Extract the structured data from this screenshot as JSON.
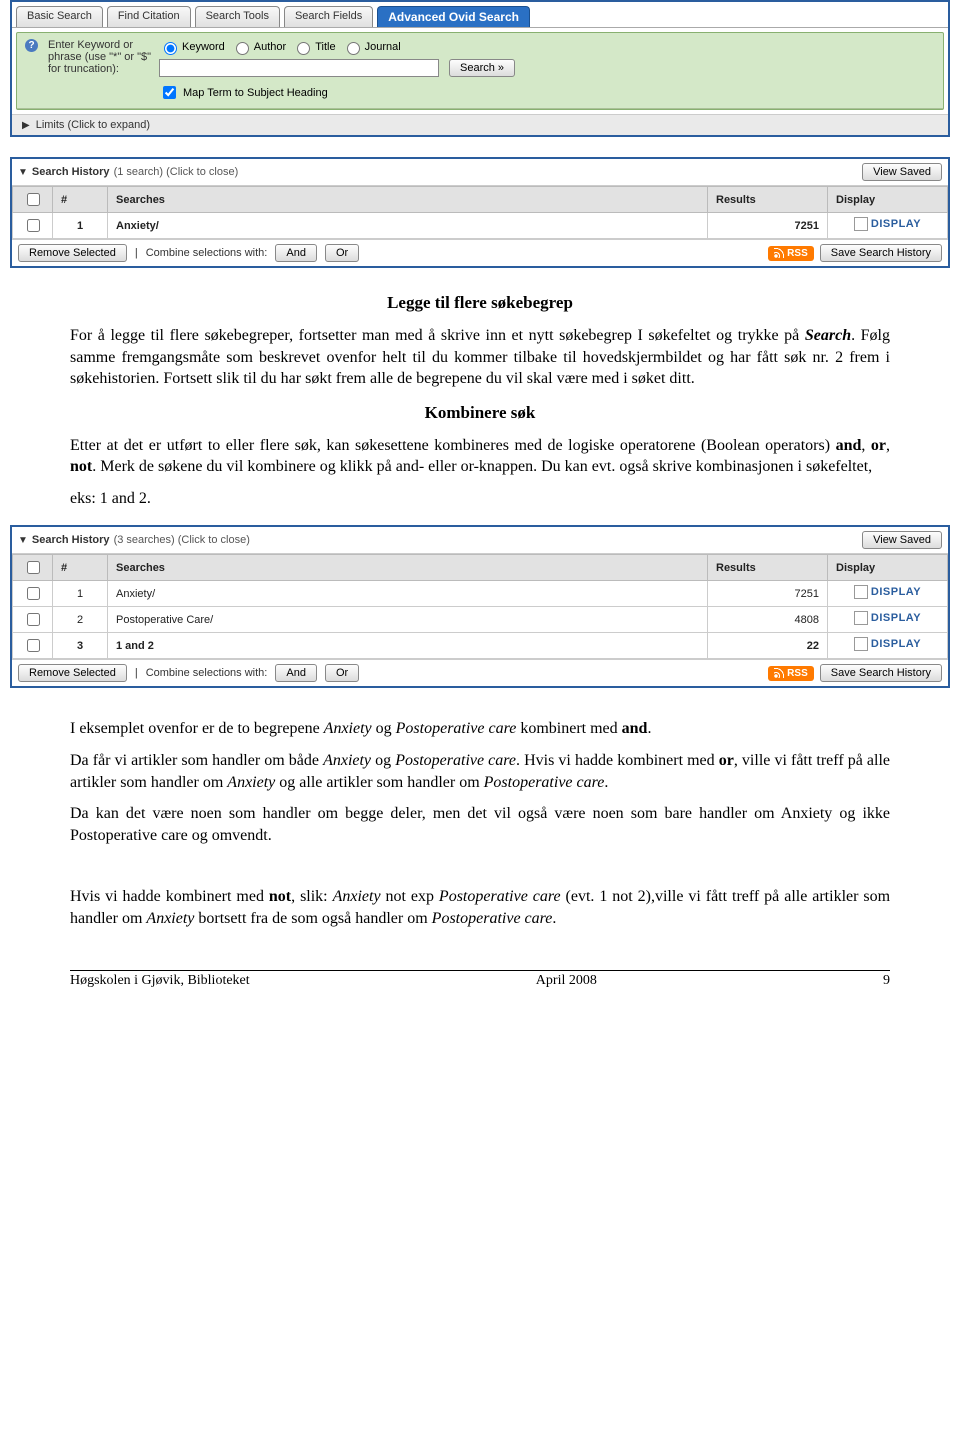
{
  "top_panel": {
    "tabs": [
      "Basic Search",
      "Find Citation",
      "Search Tools",
      "Search Fields",
      "Advanced Ovid Search"
    ],
    "active_tab": 4,
    "keyword_label": "Enter Keyword or phrase (use \"*\" or \"$\" for truncation):",
    "radios": [
      "Keyword",
      "Author",
      "Title",
      "Journal"
    ],
    "map_label": "Map Term to Subject Heading",
    "search_btn": "Search »",
    "limits": "Limits  (Click to expand)"
  },
  "hist1": {
    "title": "Search History",
    "count": "(1 search) (Click to close)",
    "view_saved": "View Saved",
    "headers": [
      "#",
      "Searches",
      "Results",
      "Display"
    ],
    "rows": [
      {
        "n": "1",
        "s": "Anxiety/",
        "r": "7251",
        "d": "DISPLAY"
      }
    ],
    "remove": "Remove Selected",
    "combine_label": "Combine selections with:",
    "and": "And",
    "or": "Or",
    "rss": "RSS",
    "save_hist": "Save Search History"
  },
  "text1": {
    "h1": "Legge til flere søkebegrep",
    "p1a": "For å legge til flere søkebegreper, fortsetter man med å skrive inn et nytt søkebegrep I søkefeltet og trykke på ",
    "p1b": "Search",
    "p1c": ". Følg samme fremgangsmåte som beskrevet ovenfor helt til du kommer tilbake til hovedskjermbildet og har fått søk nr. 2 frem i søkehistorien. Fortsett slik til du har søkt frem alle de begrepene du vil skal være med i søket ditt.",
    "h2": "Kombinere søk",
    "p2a": "Etter at det er utført to eller flere søk, kan søkesettene kombineres med de logiske operatorene (Boolean operators) ",
    "p2b": "and",
    "p2c": ", ",
    "p2d": "or",
    "p2e": ", ",
    "p2f": "not",
    "p2g": ". Merk de søkene du vil kombinere og klikk på and- eller or-knappen. Du kan evt. også skrive kombinasjonen i søkefeltet,",
    "p2h": "eks: 1 and 2."
  },
  "hist2": {
    "title": "Search History",
    "count": "(3 searches) (Click to close)",
    "view_saved": "View Saved",
    "headers": [
      "#",
      "Searches",
      "Results",
      "Display"
    ],
    "rows": [
      {
        "n": "1",
        "s": "Anxiety/",
        "r": "7251",
        "d": "DISPLAY"
      },
      {
        "n": "2",
        "s": "Postoperative Care/",
        "r": "4808",
        "d": "DISPLAY"
      },
      {
        "n": "3",
        "s": "1 and 2",
        "r": "22",
        "d": "DISPLAY",
        "bold": true
      }
    ],
    "remove": "Remove Selected",
    "combine_label": "Combine selections with:",
    "and": "And",
    "or": "Or",
    "rss": "RSS",
    "save_hist": "Save Search History"
  },
  "text2": {
    "p1a": "I eksemplet ovenfor er de to begrepene ",
    "p1b": "Anxiety",
    "p1c": " og ",
    "p1d": "Postoperative care",
    "p1e": " kombinert med ",
    "p1f": "and",
    "p1g": ".",
    "p2a": "Da får vi artikler som handler om både ",
    "p2b": "Anxiety",
    "p2c": " og ",
    "p2d": "Postoperative care",
    "p2e": ". Hvis vi hadde kombinert med ",
    "p2f": "or",
    "p2g": ", ville vi fått treff på alle artikler som handler om ",
    "p2h": "Anxiety",
    "p2i": " og alle artikler som handler om ",
    "p2j": "Postoperative care",
    "p2k": ".",
    "p3": "Da kan det være noen som handler om begge deler, men det vil også være noen som bare handler om Anxiety og ikke Postoperative care og omvendt.",
    "p4a": "Hvis vi hadde kombinert med ",
    "p4b": "not",
    "p4c": ", slik: ",
    "p4d": "Anxiety",
    "p4e": " not exp ",
    "p4f": "Postoperative care",
    "p4g": " (evt. 1 not 2),ville vi fått treff på alle artikler som handler om ",
    "p4h": "Anxiety",
    "p4i": " bortsett fra de som også handler om ",
    "p4j": "Postoperative care",
    "p4k": "."
  },
  "footer": {
    "left": "Høgskolen i Gjøvik, Biblioteket",
    "center": "April 2008",
    "right": "9"
  }
}
